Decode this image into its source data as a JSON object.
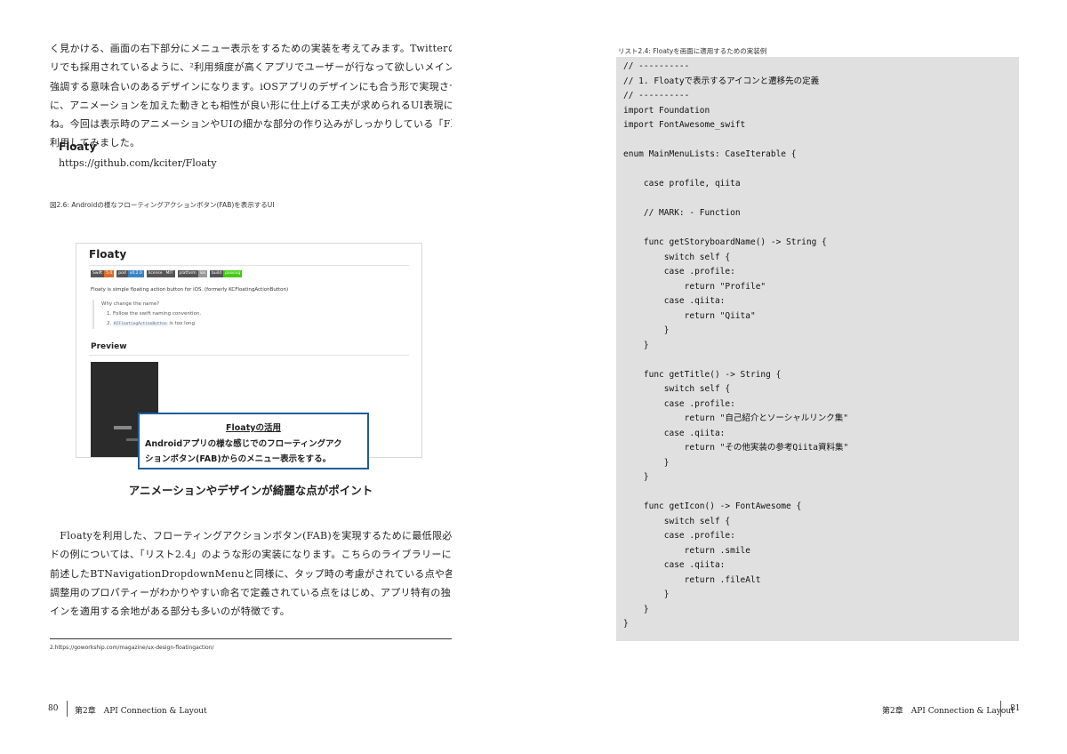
{
  "left_page": {
    "para1": [
      "く見かける、画面の右下部分にメニュー表示をするための実装を考えてみます。TwitterのiOSアプ",
      "リでも採用されているように、²利用頻度が高くアプリでユーザーが行なって欲しいメインの機能を",
      "強調する意味合いのあるデザインになります。iOSアプリのデザインにも合う形で実現させると共",
      "に、アニメーションを加えた動きとも相性が良い形に仕上げる工夫が求められるUI表現になりま す",
      "ね。今回は表示時のアニメーションやUIの細かな部分の作り込みがしっかりしている「Floaty」を",
      "利用してみました。"
    ],
    "lib_heading": "Floaty",
    "lib_url": "https://github.com/kciter/Floaty",
    "figure_caption": "図2.6: Androidの様なフローティングアクションボタン(FAB)を表示するUI",
    "figure": {
      "title": "Floaty",
      "badges": [
        {
          "key": "Swift",
          "value": "5.0",
          "color": "#e0692a"
        },
        {
          "key": "pod",
          "value": "v4.2.0",
          "color": "#3a83c5"
        },
        {
          "key": "license",
          "value": "MIT",
          "color": "#555555"
        },
        {
          "key": "platform",
          "value": "ios",
          "color": "#999999"
        },
        {
          "key": "build",
          "value": "passing",
          "color": "#4c1"
        }
      ],
      "description": "Floaty is simple floating action button for iOS. (formerly KCFloatingActionButton)",
      "quote_title": "Why change the name?",
      "quote_item1": "1. Follow the swift naming convention.",
      "quote_item2_num": "2.",
      "quote_item2_code": "KCFloatingActionButton",
      "quote_item2_rest": "is too long.",
      "preview": "Preview"
    },
    "callout": {
      "title": "Floatyの活用",
      "line1": "Androidアプリの様な感じでのフローティングアク",
      "line2": "ションボタン(FAB)からのメニュー表示をする。"
    },
    "emphasis": "アニメーションやデザインが綺麗な点がポイント",
    "para2": [
      "　Floatyを利用した、フローティングアクションボタン(FAB)を実現するために最低限必要なコー",
      "ドの例については、「リスト2.4」のような形の実装になります。こちらのライブラリーについても",
      "前述したBTNavigationDropdownMenuと同様に、タップ時の考慮がされている点や各種デザイン",
      "調整用のプロパティーがわかりやすい命名で定義されている点をはじめ、アプリ特有の独自なデザ",
      "インを適用する余地がある部分も多いのが特徴です。"
    ],
    "footnote": "2.https://goworkship.com/magazine/ux-design-floatingaction/",
    "page_number": "80",
    "running_head": "第2章　API Connection & Layout"
  },
  "right_page": {
    "list_caption": "リスト2.4: Floatyを画面に適用するための実装例",
    "code": "// ----------\n// 1. Floatyで表示するアイコンと遷移先の定義\n// ----------\nimport Foundation\nimport FontAwesome_swift\n\nenum MainMenuLists: CaseIterable {\n\n    case profile, qiita\n\n    // MARK: - Function\n\n    func getStoryboardName() -> String {\n        switch self {\n        case .profile:\n            return \"Profile\"\n        case .qiita:\n            return \"Qiita\"\n        }\n    }\n\n    func getTitle() -> String {\n        switch self {\n        case .profile:\n            return \"自己紹介とソーシャルリンク集\"\n        case .qiita:\n            return \"その他実装の参考Qiita資料集\"\n        }\n    }\n\n    func getIcon() -> FontAwesome {\n        switch self {\n        case .profile:\n            return .smile\n        case .qiita:\n            return .fileAlt\n        }\n    }\n}",
    "page_number": "81",
    "running_head": "第2章　API Connection & Layout"
  }
}
